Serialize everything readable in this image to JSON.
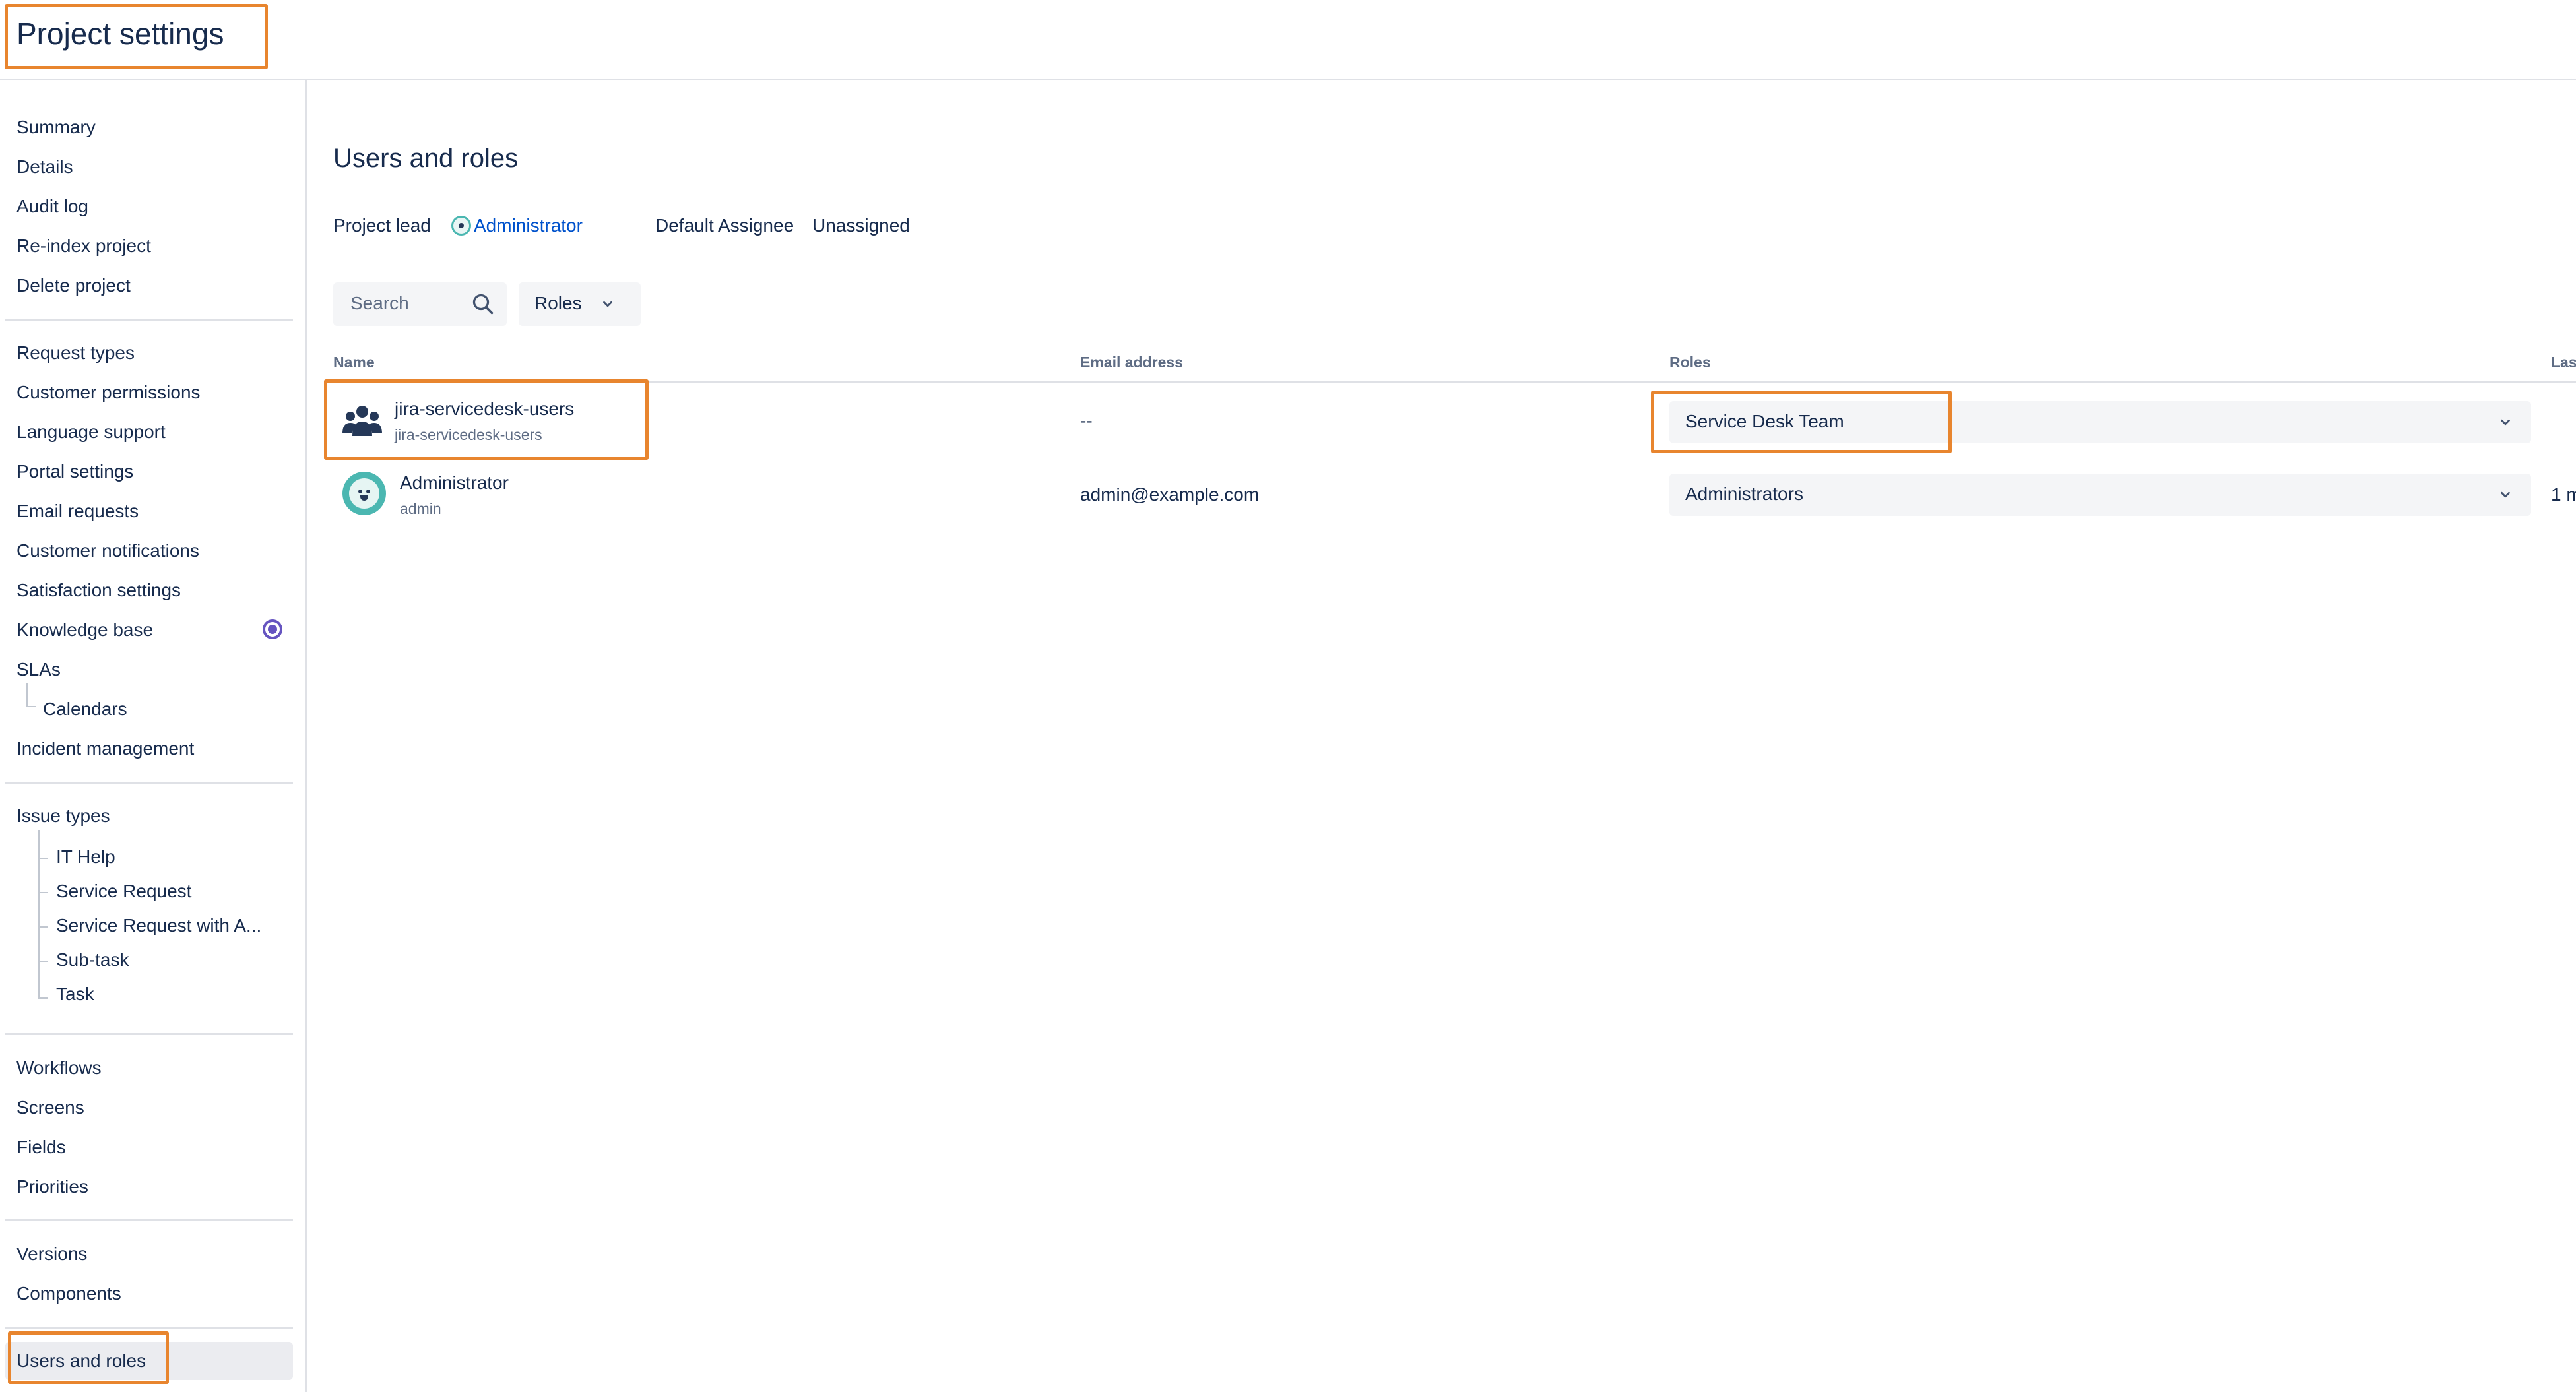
{
  "header": {
    "title": "Project settings"
  },
  "sidebar": {
    "group1": [
      "Summary",
      "Details",
      "Audit log",
      "Re-index project",
      "Delete project"
    ],
    "group2": [
      "Request types",
      "Customer permissions",
      "Language support",
      "Portal settings",
      "Email requests",
      "Customer notifications",
      "Satisfaction settings",
      "Knowledge base",
      "SLAs",
      "Calendars",
      "Incident management"
    ],
    "issue_types": {
      "label": "Issue types",
      "children": [
        "IT Help",
        "Service Request",
        "Service Request with A...",
        "Sub-task",
        "Task"
      ]
    },
    "group4": [
      "Workflows",
      "Screens",
      "Fields",
      "Priorities"
    ],
    "group5": [
      "Versions",
      "Components"
    ],
    "active": "Users and roles",
    "knowledge_base_indicator_color": "#6554c0"
  },
  "main": {
    "title": "Users and roles",
    "project_lead_label": "Project lead",
    "project_lead_value": "Administrator",
    "default_assignee_label": "Default Assignee",
    "default_assignee_value": "Unassigned",
    "search_placeholder": "Search",
    "roles_filter_label": "Roles",
    "columns": {
      "name": "Name",
      "email": "Email address",
      "roles": "Roles",
      "last": "Las"
    },
    "rows": [
      {
        "name": "jira-servicedesk-users",
        "sub": "jira-servicedesk-users",
        "email": "--",
        "role": "Service Desk Team",
        "last": "",
        "icon": "group-icon"
      },
      {
        "name": "Administrator",
        "sub": "admin",
        "email": "admin@example.com",
        "role": "Administrators",
        "last": "1 m",
        "icon": "avatar"
      }
    ]
  },
  "colors": {
    "highlight": "#e8852e",
    "link": "#0052cc",
    "text": "#172b4d",
    "muted": "#5e6c84"
  }
}
